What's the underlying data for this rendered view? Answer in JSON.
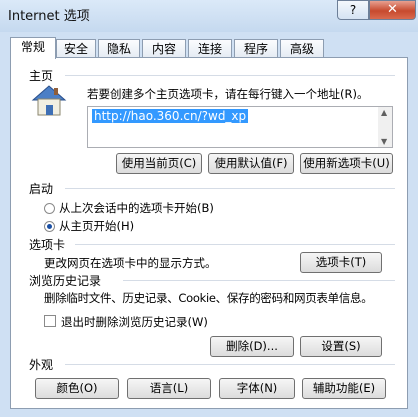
{
  "window": {
    "title": "Internet 选项",
    "help_label": "?",
    "close_label": "✕"
  },
  "tabs": [
    {
      "label": "常规"
    },
    {
      "label": "安全"
    },
    {
      "label": "隐私"
    },
    {
      "label": "内容"
    },
    {
      "label": "连接"
    },
    {
      "label": "程序"
    },
    {
      "label": "高级"
    }
  ],
  "home": {
    "section": "主页",
    "instruction": "若要创建多个主页选项卡，请在每行键入一个地址(R)。",
    "url": "http://hao.360.cn/?wd_xp",
    "use_current": "使用当前页(C)",
    "use_default": "使用默认值(F)",
    "use_new_tab": "使用新选项卡(U)"
  },
  "startup": {
    "section": "启动",
    "option_last_session": "从上次会话中的选项卡开始(B)",
    "option_home": "从主页开始(H)",
    "selected": "option_home"
  },
  "tabs_section": {
    "section": "选项卡",
    "description": "更改网页在选项卡中的显示方式。",
    "button": "选项卡(T)"
  },
  "history": {
    "section": "浏览历史记录",
    "description": "删除临时文件、历史记录、Cookie、保存的密码和网页表单信息。",
    "checkbox_label": "退出时删除浏览历史记录(W)",
    "checkbox_checked": false,
    "delete_button": "删除(D)...",
    "settings_button": "设置(S)"
  },
  "appearance": {
    "section": "外观",
    "colors": "颜色(O)",
    "languages": "语言(L)",
    "fonts": "字体(N)",
    "accessibility": "辅助功能(E)"
  }
}
